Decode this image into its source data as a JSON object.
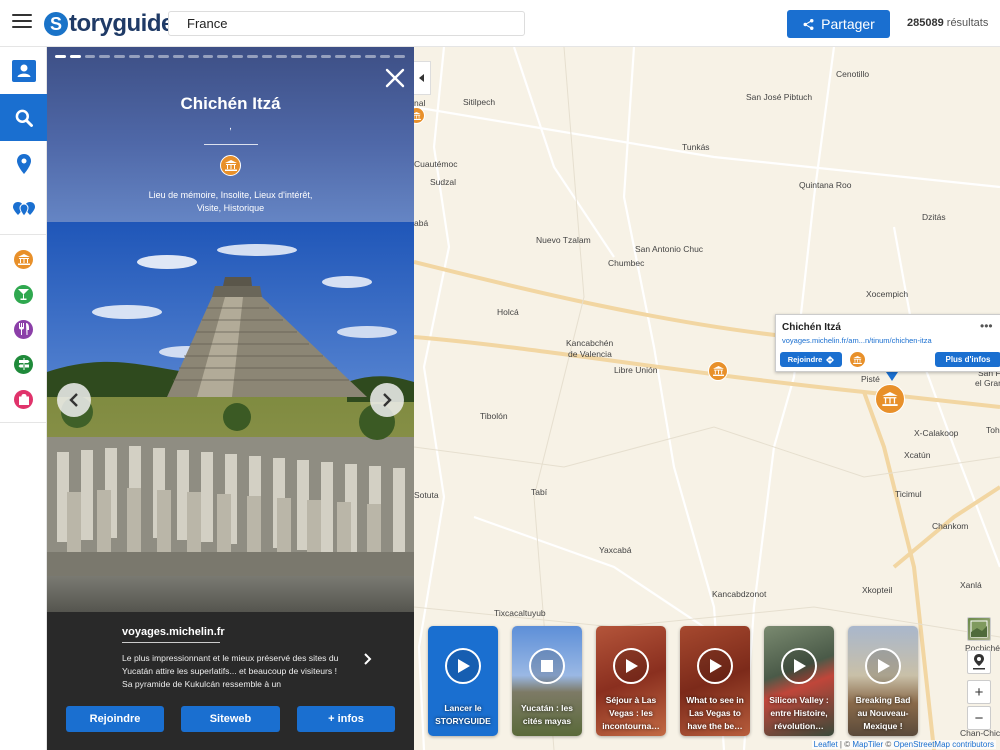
{
  "header": {
    "logo_letter": "S",
    "logo_text": "toryguide",
    "search_value": "France",
    "share_label": "Partager",
    "results_count": "285089",
    "results_label": "résultats"
  },
  "sidebar": {
    "items": [
      {
        "icon": "contact-card-icon"
      },
      {
        "icon": "search-icon"
      },
      {
        "icon": "map-pin-icon"
      },
      {
        "icon": "multi-pin-icon"
      },
      {
        "icon": "monument-icon",
        "color": "#e8902a"
      },
      {
        "icon": "cocktail-icon",
        "color": "#2fa84f"
      },
      {
        "icon": "restaurant-icon",
        "color": "#8b3fa8"
      },
      {
        "icon": "signpost-icon",
        "color": "#1f8a3a"
      },
      {
        "icon": "shopping-bag-icon",
        "color": "#e0336b"
      }
    ]
  },
  "panel": {
    "title": "Chichén Itzá",
    "subtitle": ",",
    "tags": "Lieu de mémoire, Insolite, Lieux d'intérêt, Visite, Historique",
    "source": "voyages.michelin.fr",
    "description": "Le plus impressionnant et le mieux préservé des sites du Yucatán attire les superlatifs... et beaucoup de visiteurs ! Sa pyramide de Kukulcán ressemble à un",
    "btn_join": "Rejoindre",
    "btn_website": "Siteweb",
    "btn_info": "+ infos"
  },
  "map": {
    "places": [
      {
        "name": "Sitilpech"
      },
      {
        "name": "Cenotillo"
      },
      {
        "name": "San José Pibtuch"
      },
      {
        "name": "Tunkás"
      },
      {
        "name": "Cuautémoc"
      },
      {
        "name": "Sudzal"
      },
      {
        "name": "Quintana Roo"
      },
      {
        "name": "Dzitás"
      },
      {
        "name": "Nuevo Tzalam"
      },
      {
        "name": "San Antonio Chuc"
      },
      {
        "name": "Chumbec"
      },
      {
        "name": "Xocempich"
      },
      {
        "name": "Holcá"
      },
      {
        "name": "Kancabchén"
      },
      {
        "name": "de Valencia"
      },
      {
        "name": "Libre Unión"
      },
      {
        "name": "Pisté"
      },
      {
        "name": "Tibolón"
      },
      {
        "name": "X-Calakoop"
      },
      {
        "name": "Xcatún"
      },
      {
        "name": "Tabí"
      },
      {
        "name": "Ticimul"
      },
      {
        "name": "Chankom"
      },
      {
        "name": "Yaxcabá"
      },
      {
        "name": "Kancabdzonot"
      },
      {
        "name": "Xkopteil"
      },
      {
        "name": "Xanlá"
      },
      {
        "name": "Tixcacaltuyub"
      },
      {
        "name": "Sotuta"
      },
      {
        "name": "nal"
      },
      {
        "name": "abá"
      },
      {
        "name": "Toh"
      },
      {
        "name": "Chan-Chic"
      },
      {
        "name": "San Fr"
      },
      {
        "name": "el Gran"
      },
      {
        "name": "Pochiché"
      }
    ],
    "popup": {
      "title": "Chichén Itzá",
      "url": "voyages.michelin.fr/am...n/tinum/chichen-itza",
      "join_label": "Rejoindre",
      "info_label": "Plus d'infos"
    },
    "stories": [
      {
        "label": "Lancer le STORYGUIDE",
        "style": "blue"
      },
      {
        "label": "Yucatán : les cités mayas",
        "style": "stop"
      },
      {
        "label": "Séjour à Las Vegas : les incontourna…",
        "style": "red"
      },
      {
        "label": "What to see in Las Vegas to have the be…",
        "style": "red"
      },
      {
        "label": "Silicon Valley : entre Histoire, révolution…",
        "style": "city"
      },
      {
        "label": "Breaking Bad au Nouveau-Mexique !",
        "style": "desert"
      }
    ],
    "zoom_in": "+",
    "zoom_out": "−",
    "attribution": {
      "leaflet": "Leaflet",
      "sep": " | © ",
      "maptiler": "MapTiler",
      "sep2": " © ",
      "osm": "OpenStreetMap contributors"
    }
  },
  "colors": {
    "primary": "#1a6fd0",
    "poi_orange": "#e8902a",
    "map_bg": "#f7f2e6"
  }
}
